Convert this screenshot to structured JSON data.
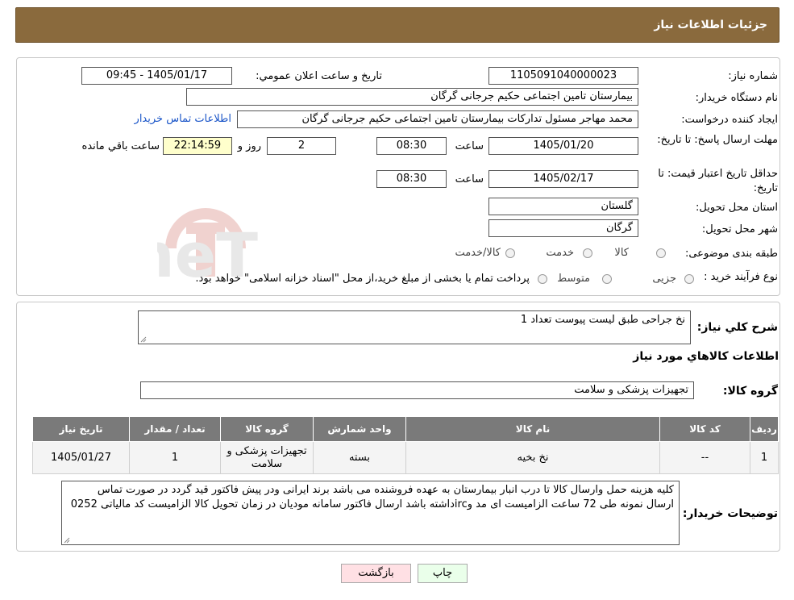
{
  "header": {
    "title": "جزئیات اطلاعات نیاز"
  },
  "form": {
    "need_number_label": "شماره نیاز:",
    "need_number": "1105091040000023",
    "announce_label": "تاریخ و ساعت اعلان عمومي:",
    "announce_value": "1405/01/17 - 09:45",
    "buyer_org_label": "نام دستگاه خریدار:",
    "buyer_org": "بیمارستان تامین اجتماعی حکیم جرجانی گرگان",
    "creator_label": "ایجاد کننده درخواست:",
    "creator": "محمد مهاجر مسئول تدارکات بیمارستان تامین اجتماعی حکیم جرجانی گرگان",
    "contact_link": "اطلاعات تماس خریدار",
    "deadline_label": "مهلت ارسال پاسخ: تا تاریخ:",
    "deadline_date": "1405/01/20",
    "time_label": "ساعت",
    "deadline_time": "08:30",
    "days_value": "2",
    "days_label": "روز و",
    "remaining_time": "22:14:59",
    "remaining_label": "ساعت باقي مانده",
    "validity_label": "حداقل تاریخ اعتبار قیمت: تا تاریخ:",
    "validity_date": "1405/02/17",
    "validity_time": "08:30",
    "province_label": "استان محل تحویل:",
    "province": "گلستان",
    "city_label": "شهر محل تحویل:",
    "city": "گرگان",
    "category_label": "طبقه بندی موضوعی:",
    "category_options": [
      "کالا",
      "خدمت",
      "کالا/خدمت"
    ],
    "process_label": "نوع فرآیند خرید :",
    "process_options": [
      "جزیی",
      "متوسط"
    ],
    "process_note": "پرداخت تمام یا بخشی از مبلغ خرید،از محل \"اسناد خزانه اسلامی\" خواهد بود."
  },
  "details": {
    "summary_label": "شرح کلي نیاز:",
    "summary": "نخ جراحی طبق لیست پیوست تعداد 1",
    "goods_info_title": "اطلاعات کالاهاي مورد نیاز",
    "group_label": "گروه کالا:",
    "group_value": "تجهیزات پزشکی و سلامت",
    "table": {
      "headers": [
        "ردیف",
        "کد کالا",
        "نام کالا",
        "واحد شمارش",
        "گروه کالا",
        "تعداد / مقدار",
        "تاریخ نیاز"
      ],
      "row": [
        "1",
        "--",
        "نخ بخیه",
        "بسته",
        "تجهیزات پزشکی و سلامت",
        "1",
        "1405/01/27"
      ]
    },
    "buyer_notes_label": "توضیحات خریدار:",
    "buyer_notes": "کلیه هزینه حمل وارسال کالا تا درب انبار بیمارستان به عهده فروشنده می باشد برند ایرانی ودر پیش فاکتور قید گردد در صورت تماس ارسال نمونه طی 72 ساعت الزامیست  ای مد  وircداشته باشد ارسال فاکتور سامانه مودیان در زمان تحویل کالا الزامیست کد مالیاتی 0252"
  },
  "buttons": {
    "back": "بازگشت",
    "print": "چاپ"
  },
  "watermark": {
    "text": "AriaTender.neT"
  }
}
